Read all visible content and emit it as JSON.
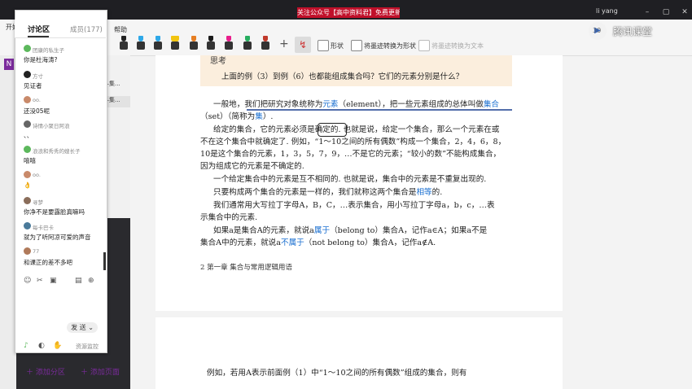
{
  "titlebar": {
    "banner": "关注公众号【高中资料君】免费更新2022网课",
    "user": "li yang",
    "min": "–",
    "restore": "▢",
    "close": "✕"
  },
  "ribbon": {
    "menu_start": "开始",
    "menu_help": "帮助",
    "shape_label": "形状",
    "ink_to_shape": "将墨迹转换为形状",
    "ink_to_text": "将墨迹转换为文本",
    "plus": "+",
    "lasso": "↯"
  },
  "pens": [
    "#222222",
    "#2ea8e8",
    "#2ea8e8",
    "#f1c40f",
    "#e67e22",
    "#1a1a1a",
    "#e91e8c",
    "#27ae60",
    "#c0392b"
  ],
  "pagelist": {
    "item1": "串—集...",
    "item2": "串—集..."
  },
  "discussion": {
    "tab_discuss": "讨论区",
    "tab_members": "成员(177)",
    "messages": [
      {
        "name": "团康的私生子",
        "text": "你是杜海涛?"
      },
      {
        "name": "方寸",
        "text": "见证者"
      },
      {
        "name": "oo.",
        "text": "还没05呢"
      },
      {
        "name": "诗情小聚日阿浪",
        "text": "、、"
      },
      {
        "name": "浪浪和秀秀的嫂长子",
        "text": "嘻嘻"
      },
      {
        "name": "oo.",
        "text": "👌"
      },
      {
        "name": "寻梦",
        "text": "你净不是要露脸真嘛吗"
      },
      {
        "name": "每卡巴卡",
        "text": "就为了听阿凉可爱的声音"
      },
      {
        "name": "77",
        "text": "和课正的差不多吧"
      }
    ],
    "send_label": "发 送",
    "send_arrow": "⌄",
    "status": "资源监控"
  },
  "document": {
    "think_label": "思考",
    "think_question": "上面的例（3）到例（6）也都能组成集合吗？它们的元素分别是什么？",
    "paragraphs": [
      {
        "pre": "一般地，我们把研究对象统称为",
        "hl": "元素",
        "post": "（element），把一些元素组成的总体叫做",
        "hl2": "集合"
      },
      {
        "pre": "（set）（简称为",
        "hl": "集",
        "post": "）."
      },
      {
        "pre": "给定的集合，它的元素必须是确定的. 也就是说，给定一个集合，那么一个元素在或"
      },
      {
        "pre": "不在这个集合中就确定了. 例如，“1～10之间的所有偶数”构成一个集合，2，4，6，8，"
      },
      {
        "pre": "10是这个集合的元素，1，3，5，7，9，…不是它的元素；“较小的数”不能构成集合，"
      },
      {
        "pre": "因为组成它的元素是不确定的."
      },
      {
        "pre": "一个给定集合中的元素是互不相同的. 也就是说，集合中的元素是不重复出现的."
      },
      {
        "pre": "只要构成两个集合的元素是一样的，我们就称这两个集合是",
        "hl": "相等",
        "post": "的."
      },
      {
        "pre": "我们通常用大写拉丁字母A，B，C，…表示集合，用小写拉丁字母a，b，c，…表"
      },
      {
        "pre": "示集合中的元素."
      },
      {
        "pre": "如果a是集合A的元素，就说a",
        "hl": "属于",
        "post": "（belong to）集合A，记作a∈A；如果a不是"
      },
      {
        "pre": "集合A中的元素，就说a",
        "hl": "不属于",
        "post": "（not belong to）集合A，记作a∉A."
      }
    ],
    "footer": "2   第一章  集合与常用逻辑用语",
    "page2_text": "例如，若用A表示前面例（1）中“1～10之间的所有偶数”组成的集合，则有"
  },
  "bottom": {
    "add_section": "添加分区",
    "add_page": "添加页面"
  },
  "tencent": {
    "label": "腾讯课堂",
    "number": "30"
  }
}
